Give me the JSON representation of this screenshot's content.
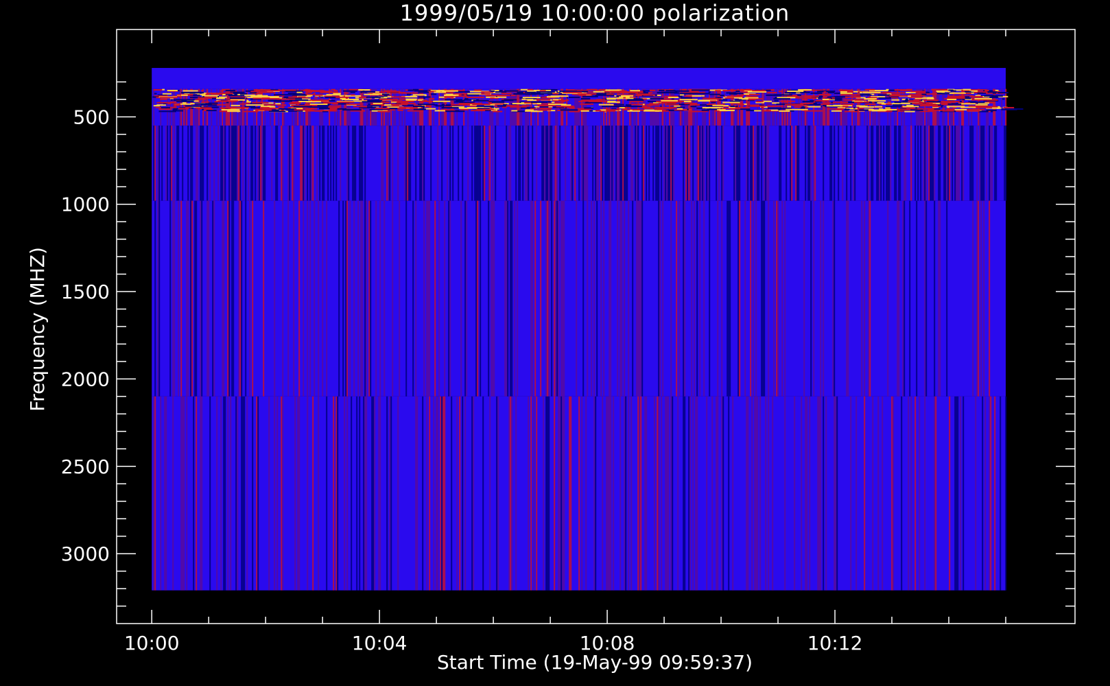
{
  "chart_data": {
    "type": "heatmap",
    "title": "1999/05/19 10:00:00 polarization",
    "xlabel": "Start Time (19-May-99 09:59:37)",
    "ylabel": "Frequency (MHZ)",
    "x_range_minutes": [
      -0.617,
      16.217
    ],
    "y_range_mhz": [
      3400,
      0
    ],
    "y_axis_inverted": true,
    "x_major_ticks": [
      {
        "minutes": 0,
        "label": "10:00"
      },
      {
        "minutes": 4,
        "label": "10:04"
      },
      {
        "minutes": 8,
        "label": "10:08"
      },
      {
        "minutes": 12,
        "label": "10:12"
      }
    ],
    "x_minor_step_minutes": 1,
    "y_major_ticks": [
      {
        "mhz": 500,
        "label": "500"
      },
      {
        "mhz": 1000,
        "label": "1000"
      },
      {
        "mhz": 1500,
        "label": "1500"
      },
      {
        "mhz": 2000,
        "label": "2000"
      },
      {
        "mhz": 2500,
        "label": "2500"
      },
      {
        "mhz": 3000,
        "label": "3000"
      }
    ],
    "y_minor_step_mhz": 100,
    "data_extent": {
      "time_minutes": [
        0,
        15
      ],
      "frequency_mhz": [
        220,
        3210
      ]
    },
    "frequency_bands_mhz": [
      {
        "range": [
          220,
          340
        ],
        "appearance": "uniform"
      },
      {
        "range": [
          340,
          550
        ],
        "appearance": "bursty"
      },
      {
        "range": [
          550,
          980
        ],
        "appearance": "dark-streaked"
      },
      {
        "range": [
          980,
          2100
        ],
        "appearance": "streaked"
      },
      {
        "range": [
          2100,
          3210
        ],
        "appearance": "streaked"
      }
    ],
    "colors": {
      "background": "#000000",
      "axes": "#ffffff",
      "base": "#2a0aee",
      "low": "#00007a",
      "mid": "#5a0a9a",
      "high": "#c8102a",
      "peak": "#ffd040"
    },
    "grid": false,
    "legend": "none"
  }
}
